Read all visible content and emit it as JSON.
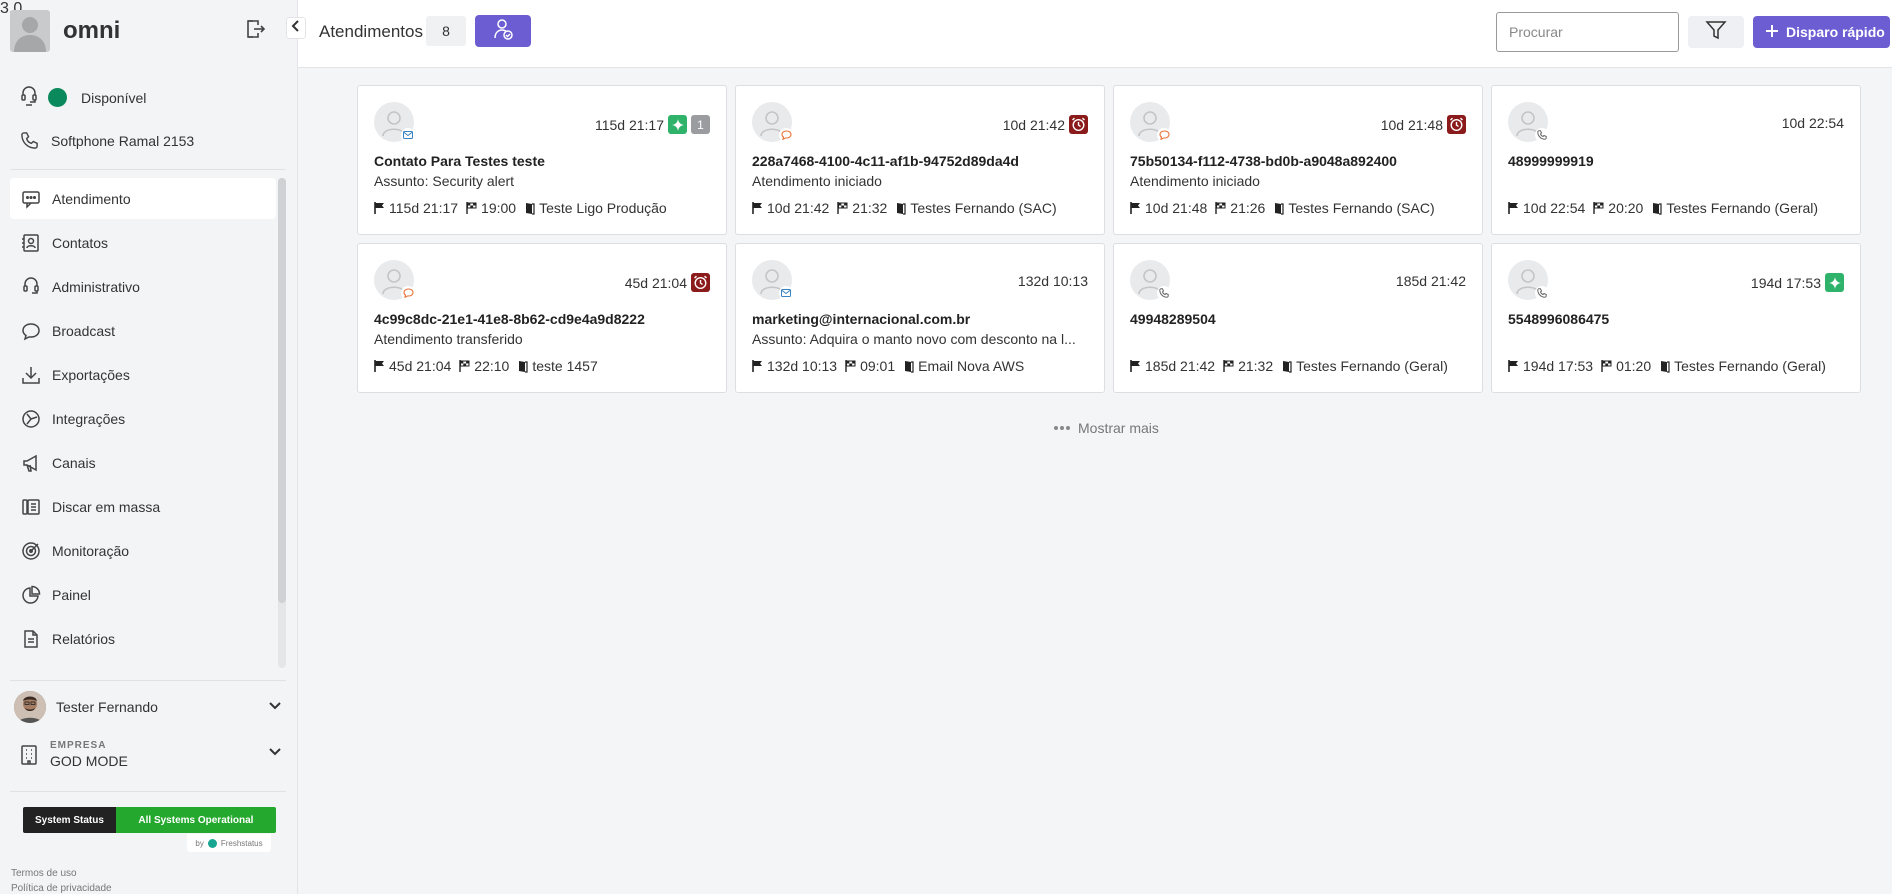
{
  "app": {
    "name": "omni",
    "version": "3.0"
  },
  "agent_status": {
    "label": "Disponível",
    "color": "#0a8a5c"
  },
  "softphone": {
    "label": "Softphone Ramal 2153"
  },
  "nav": {
    "items": [
      {
        "label": "Atendimento",
        "icon": "chat-icon",
        "active": true
      },
      {
        "label": "Contatos",
        "icon": "contacts-icon"
      },
      {
        "label": "Administrativo",
        "icon": "admin-icon"
      },
      {
        "label": "Broadcast",
        "icon": "broadcast-icon"
      },
      {
        "label": "Exportações",
        "icon": "download-icon"
      },
      {
        "label": "Integrações",
        "icon": "integrations-icon"
      },
      {
        "label": "Canais",
        "icon": "megaphone-icon"
      },
      {
        "label": "Discar em massa",
        "icon": "dialer-icon"
      },
      {
        "label": "Monitoração",
        "icon": "target-icon"
      },
      {
        "label": "Painel",
        "icon": "piechart-icon"
      },
      {
        "label": "Relatórios",
        "icon": "reports-icon"
      }
    ]
  },
  "user": {
    "name": "Tester Fernando"
  },
  "company": {
    "label": "EMPRESA",
    "name": "GOD MODE"
  },
  "system_status": {
    "label": "System Status",
    "value": "All Systems Operational",
    "by": "by",
    "provider": "Freshstatus"
  },
  "footer": {
    "terms": "Termos de uso",
    "privacy": "Política de privacidade"
  },
  "header": {
    "title": "Atendimentos",
    "count": "8",
    "search_placeholder": "Procurar",
    "quick_send": "Disparo rápido"
  },
  "cards": [
    {
      "time": "115d 21:17",
      "badges": [
        "new",
        "count"
      ],
      "badge_count": "1",
      "channel": "email-icon",
      "name": "Contato Para Testes teste",
      "subtitle": "Assunto: Security alert",
      "start": "115d 21:17",
      "end": "19:00",
      "queue": "Teste Ligo Produção"
    },
    {
      "time": "10d 21:42",
      "badges": [
        "clock"
      ],
      "channel": "chat-bubble-icon",
      "name": "228a7468-4100-4c11-af1b-94752d89da4d",
      "subtitle": "Atendimento iniciado",
      "start": "10d 21:42",
      "end": "21:32",
      "queue": "Testes Fernando (SAC)"
    },
    {
      "time": "10d 21:48",
      "badges": [
        "clock"
      ],
      "channel": "chat-bubble-icon",
      "name": "75b50134-f112-4738-bd0b-a9048a892400",
      "subtitle": "Atendimento iniciado",
      "start": "10d 21:48",
      "end": "21:26",
      "queue": "Testes Fernando (SAC)"
    },
    {
      "time": "10d 22:54",
      "badges": [],
      "channel": "phone-icon",
      "name": "48999999919",
      "subtitle": "",
      "start": "10d 22:54",
      "end": "20:20",
      "queue": "Testes Fernando (Geral)"
    },
    {
      "time": "45d 21:04",
      "badges": [
        "clock"
      ],
      "channel": "chat-bubble-icon",
      "name": "4c99c8dc-21e1-41e8-8b62-cd9e4a9d8222",
      "subtitle": "Atendimento transferido",
      "start": "45d 21:04",
      "end": "22:10",
      "queue": "teste 1457"
    },
    {
      "time": "132d 10:13",
      "badges": [],
      "channel": "email-icon",
      "name": "marketing@internacional.com.br",
      "subtitle": "Assunto: Adquira o manto novo com desconto na l...",
      "start": "132d 10:13",
      "end": "09:01",
      "queue": "Email Nova AWS"
    },
    {
      "time": "185d 21:42",
      "badges": [],
      "channel": "phone-icon",
      "name": "49948289504",
      "subtitle": "",
      "start": "185d 21:42",
      "end": "21:32",
      "queue": "Testes Fernando (Geral)"
    },
    {
      "time": "194d 17:53",
      "badges": [
        "new"
      ],
      "channel": "phone-icon",
      "name": "5548996086475",
      "subtitle": "",
      "start": "194d 17:53",
      "end": "01:20",
      "queue": "Testes Fernando (Geral)"
    }
  ],
  "show_more": "Mostrar mais",
  "colors": {
    "primary": "#6c5dd3",
    "new_badge": "#2fb36b",
    "clock_badge": "#8b1a1a",
    "status_ok": "#25a82e"
  }
}
